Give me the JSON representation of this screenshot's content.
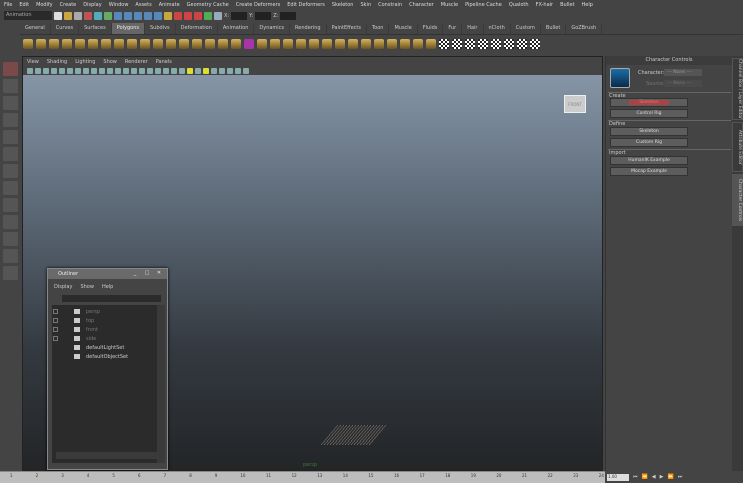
{
  "menubar": [
    "File",
    "Edit",
    "Modify",
    "Create",
    "Display",
    "Window",
    "Assets",
    "Animate",
    "Geometry Cache",
    "Create Deformers",
    "Edit Deformers",
    "Skeleton",
    "Skin",
    "Constrain",
    "Character",
    "Muscle",
    "Pipeline Cache",
    "Qualoth",
    "FX-hair",
    "Bullet",
    "Help"
  ],
  "toolbar": {
    "mode": "Animation",
    "x_label": "X:",
    "y_label": "Y:",
    "z_label": "Z:"
  },
  "shelf_tabs": [
    "General",
    "Curves",
    "Surfaces",
    "Polygons",
    "Subdivs",
    "Deformation",
    "Animation",
    "Dynamics",
    "Rendering",
    "PaintEffects",
    "Toon",
    "Muscle",
    "Fluids",
    "Fur",
    "Hair",
    "nCloth",
    "Custom",
    "Bullet",
    "GoZBrush"
  ],
  "active_shelf": "Polygons",
  "viewport": {
    "menu": [
      "View",
      "Shading",
      "Lighting",
      "Show",
      "Renderer",
      "Panels"
    ],
    "viewcube": "FRONT",
    "camera": "persp"
  },
  "outliner": {
    "title": "Outliner",
    "menu": [
      "Display",
      "Show",
      "Help"
    ],
    "items": [
      {
        "name": "persp",
        "dim": true
      },
      {
        "name": "top",
        "dim": true
      },
      {
        "name": "front",
        "dim": true
      },
      {
        "name": "side",
        "dim": true
      },
      {
        "name": "defaultLightSet",
        "dim": false
      },
      {
        "name": "defaultObjectSet",
        "dim": false
      }
    ]
  },
  "character_controls": {
    "title": "Character Controls",
    "character_label": "Character:",
    "character_value": "--- None ---",
    "source_label": "Source:",
    "source_value": "--- None ---",
    "create_label": "Create",
    "skeleton_btn": "Skeleton",
    "control_rig_btn": "Control Rig",
    "define_label": "Define",
    "define_skeleton_btn": "Skeleton",
    "custom_rig_btn": "Custom Rig",
    "import_label": "Import",
    "humanik_btn": "HumanIK Example",
    "mocap_btn": "Mocap Example"
  },
  "side_tabs": [
    "Channel Box / Layer Editor",
    "Attribute Editor",
    "Character Controls"
  ],
  "timeline": {
    "ticks": [
      "1",
      "2",
      "3",
      "4",
      "5",
      "6",
      "7",
      "8",
      "9",
      "10",
      "11",
      "12",
      "13",
      "14",
      "15",
      "16",
      "17",
      "18",
      "19",
      "20",
      "21",
      "22",
      "23",
      "24"
    ],
    "current_frame": "1.00"
  }
}
